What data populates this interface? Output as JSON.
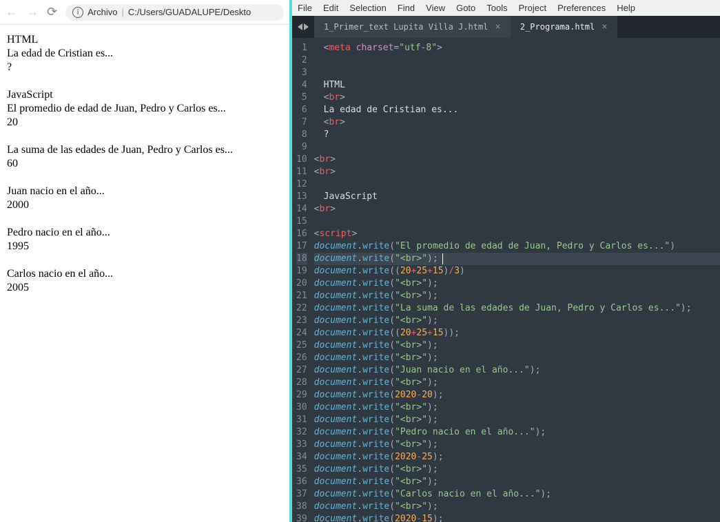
{
  "browser": {
    "address": {
      "label": "Archivo",
      "path": "C:/Users/GUADALUPE/Deskto"
    },
    "lines": [
      "HTML",
      "La edad de Cristian es...",
      "?",
      "",
      "JavaScript",
      "El promedio de edad de Juan, Pedro y Carlos es...",
      "20",
      "",
      "La suma de las edades de Juan, Pedro y Carlos es...",
      "60",
      "",
      "Juan nacio en el año...",
      "2000",
      "",
      "Pedro nacio en el año...",
      "1995",
      "",
      "Carlos nacio en el año...",
      "2005"
    ]
  },
  "editor": {
    "menu": [
      "File",
      "Edit",
      "Selection",
      "Find",
      "View",
      "Goto",
      "Tools",
      "Project",
      "Preferences",
      "Help"
    ],
    "tabs": [
      {
        "label": "1_Primer_text Lupita Villa J.html",
        "active": false
      },
      {
        "label": "2_Programa.html",
        "active": true
      }
    ],
    "highlight_line": 18,
    "code": [
      {
        "n": 1,
        "seg": [
          [
            "p",
            "<"
          ],
          [
            "tg",
            "meta"
          ],
          [
            "p",
            " "
          ],
          [
            "at",
            "charset"
          ],
          [
            "p",
            "="
          ],
          [
            "st",
            "\"utf-8\""
          ],
          [
            "p",
            ">"
          ]
        ]
      },
      {
        "n": 2,
        "seg": []
      },
      {
        "n": 3,
        "seg": []
      },
      {
        "n": 4,
        "seg": [
          [
            "tx",
            "HTML"
          ]
        ]
      },
      {
        "n": 5,
        "seg": [
          [
            "p",
            "<"
          ],
          [
            "tg",
            "br"
          ],
          [
            "p",
            ">"
          ]
        ]
      },
      {
        "n": 6,
        "seg": [
          [
            "tx",
            "La edad de Cristian es..."
          ]
        ]
      },
      {
        "n": 7,
        "seg": [
          [
            "p",
            "<"
          ],
          [
            "tg",
            "br"
          ],
          [
            "p",
            ">"
          ]
        ]
      },
      {
        "n": 8,
        "seg": [
          [
            "tx",
            "?"
          ]
        ]
      },
      {
        "n": 9,
        "seg": []
      },
      {
        "n": 10,
        "seg": [
          [
            "p",
            "<"
          ],
          [
            "tg",
            "br"
          ],
          [
            "p",
            ">"
          ]
        ],
        "dedent": true
      },
      {
        "n": 11,
        "seg": [
          [
            "p",
            "<"
          ],
          [
            "tg",
            "br"
          ],
          [
            "p",
            ">"
          ]
        ],
        "dedent": true
      },
      {
        "n": 12,
        "seg": []
      },
      {
        "n": 13,
        "seg": [
          [
            "tx",
            "JavaScript"
          ]
        ]
      },
      {
        "n": 14,
        "seg": [
          [
            "p",
            "<"
          ],
          [
            "tg",
            "br"
          ],
          [
            "p",
            ">"
          ]
        ],
        "dedent": true
      },
      {
        "n": 15,
        "seg": []
      },
      {
        "n": 16,
        "seg": [
          [
            "p",
            "<"
          ],
          [
            "tg",
            "script"
          ],
          [
            "p",
            ">"
          ]
        ],
        "dedent": true
      },
      {
        "n": 17,
        "seg": [
          [
            "kw",
            "document"
          ],
          [
            "p",
            "."
          ],
          [
            "fn",
            "write"
          ],
          [
            "p",
            "("
          ],
          [
            "st",
            "\"El promedio de edad de Juan, Pedro y Carlos es...\""
          ],
          [
            "p",
            ")"
          ]
        ],
        "dedent": true
      },
      {
        "n": 18,
        "seg": [
          [
            "kw",
            "document"
          ],
          [
            "p",
            "."
          ],
          [
            "fn",
            "write"
          ],
          [
            "p",
            "("
          ],
          [
            "st",
            "\"<br>\""
          ],
          [
            "p",
            ");"
          ]
        ],
        "dedent": true,
        "cursor": 186
      },
      {
        "n": 19,
        "seg": [
          [
            "kw",
            "document"
          ],
          [
            "p",
            "."
          ],
          [
            "fn",
            "write"
          ],
          [
            "p",
            "(("
          ],
          [
            "nm",
            "20"
          ],
          [
            "op",
            "+"
          ],
          [
            "nm",
            "25"
          ],
          [
            "op",
            "+"
          ],
          [
            "nm",
            "15"
          ],
          [
            "p",
            ")"
          ],
          [
            "op",
            "/"
          ],
          [
            "nm",
            "3"
          ],
          [
            "p",
            ")"
          ]
        ],
        "dedent": true
      },
      {
        "n": 20,
        "seg": [
          [
            "kw",
            "document"
          ],
          [
            "p",
            "."
          ],
          [
            "fn",
            "write"
          ],
          [
            "p",
            "("
          ],
          [
            "st",
            "\"<br>\""
          ],
          [
            "p",
            ");"
          ]
        ],
        "dedent": true
      },
      {
        "n": 21,
        "seg": [
          [
            "kw",
            "document"
          ],
          [
            "p",
            "."
          ],
          [
            "fn",
            "write"
          ],
          [
            "p",
            "("
          ],
          [
            "st",
            "\"<br>\""
          ],
          [
            "p",
            ");"
          ]
        ],
        "dedent": true
      },
      {
        "n": 22,
        "seg": [
          [
            "kw",
            "document"
          ],
          [
            "p",
            "."
          ],
          [
            "fn",
            "write"
          ],
          [
            "p",
            "("
          ],
          [
            "st",
            "\"La suma de las edades de Juan, Pedro y Carlos es...\""
          ],
          [
            "p",
            ");"
          ]
        ],
        "dedent": true
      },
      {
        "n": 23,
        "seg": [
          [
            "kw",
            "document"
          ],
          [
            "p",
            "."
          ],
          [
            "fn",
            "write"
          ],
          [
            "p",
            "("
          ],
          [
            "st",
            "\"<br>\""
          ],
          [
            "p",
            ");"
          ]
        ],
        "dedent": true
      },
      {
        "n": 24,
        "seg": [
          [
            "kw",
            "document"
          ],
          [
            "p",
            "."
          ],
          [
            "fn",
            "write"
          ],
          [
            "p",
            "(("
          ],
          [
            "nm",
            "20"
          ],
          [
            "op",
            "+"
          ],
          [
            "nm",
            "25"
          ],
          [
            "op",
            "+"
          ],
          [
            "nm",
            "15"
          ],
          [
            "p",
            "));"
          ]
        ],
        "dedent": true
      },
      {
        "n": 25,
        "seg": [
          [
            "kw",
            "document"
          ],
          [
            "p",
            "."
          ],
          [
            "fn",
            "write"
          ],
          [
            "p",
            "("
          ],
          [
            "st",
            "\"<br>\""
          ],
          [
            "p",
            ");"
          ]
        ],
        "dedent": true
      },
      {
        "n": 26,
        "seg": [
          [
            "kw",
            "document"
          ],
          [
            "p",
            "."
          ],
          [
            "fn",
            "write"
          ],
          [
            "p",
            "("
          ],
          [
            "st",
            "\"<br>\""
          ],
          [
            "p",
            ");"
          ]
        ],
        "dedent": true
      },
      {
        "n": 27,
        "seg": [
          [
            "kw",
            "document"
          ],
          [
            "p",
            "."
          ],
          [
            "fn",
            "write"
          ],
          [
            "p",
            "("
          ],
          [
            "st",
            "\"Juan nacio en el año...\""
          ],
          [
            "p",
            ");"
          ]
        ],
        "dedent": true
      },
      {
        "n": 28,
        "seg": [
          [
            "kw",
            "document"
          ],
          [
            "p",
            "."
          ],
          [
            "fn",
            "write"
          ],
          [
            "p",
            "("
          ],
          [
            "st",
            "\"<br>\""
          ],
          [
            "p",
            ");"
          ]
        ],
        "dedent": true
      },
      {
        "n": 29,
        "seg": [
          [
            "kw",
            "document"
          ],
          [
            "p",
            "."
          ],
          [
            "fn",
            "write"
          ],
          [
            "p",
            "("
          ],
          [
            "nm",
            "2020"
          ],
          [
            "op",
            "-"
          ],
          [
            "nm",
            "20"
          ],
          [
            "p",
            ");"
          ]
        ],
        "dedent": true
      },
      {
        "n": 30,
        "seg": [
          [
            "kw",
            "document"
          ],
          [
            "p",
            "."
          ],
          [
            "fn",
            "write"
          ],
          [
            "p",
            "("
          ],
          [
            "st",
            "\"<br>\""
          ],
          [
            "p",
            ");"
          ]
        ],
        "dedent": true
      },
      {
        "n": 31,
        "seg": [
          [
            "kw",
            "document"
          ],
          [
            "p",
            "."
          ],
          [
            "fn",
            "write"
          ],
          [
            "p",
            "("
          ],
          [
            "st",
            "\"<br>\""
          ],
          [
            "p",
            ");"
          ]
        ],
        "dedent": true
      },
      {
        "n": 32,
        "seg": [
          [
            "kw",
            "document"
          ],
          [
            "p",
            "."
          ],
          [
            "fn",
            "write"
          ],
          [
            "p",
            "("
          ],
          [
            "st",
            "\"Pedro nacio en el año...\""
          ],
          [
            "p",
            ");"
          ]
        ],
        "dedent": true
      },
      {
        "n": 33,
        "seg": [
          [
            "kw",
            "document"
          ],
          [
            "p",
            "."
          ],
          [
            "fn",
            "write"
          ],
          [
            "p",
            "("
          ],
          [
            "st",
            "\"<br>\""
          ],
          [
            "p",
            ");"
          ]
        ],
        "dedent": true
      },
      {
        "n": 34,
        "seg": [
          [
            "kw",
            "document"
          ],
          [
            "p",
            "."
          ],
          [
            "fn",
            "write"
          ],
          [
            "p",
            "("
          ],
          [
            "nm",
            "2020"
          ],
          [
            "op",
            "-"
          ],
          [
            "nm",
            "25"
          ],
          [
            "p",
            ");"
          ]
        ],
        "dedent": true
      },
      {
        "n": 35,
        "seg": [
          [
            "kw",
            "document"
          ],
          [
            "p",
            "."
          ],
          [
            "fn",
            "write"
          ],
          [
            "p",
            "("
          ],
          [
            "st",
            "\"<br>\""
          ],
          [
            "p",
            ");"
          ]
        ],
        "dedent": true
      },
      {
        "n": 36,
        "seg": [
          [
            "kw",
            "document"
          ],
          [
            "p",
            "."
          ],
          [
            "fn",
            "write"
          ],
          [
            "p",
            "("
          ],
          [
            "st",
            "\"<br>\""
          ],
          [
            "p",
            ");"
          ]
        ],
        "dedent": true
      },
      {
        "n": 37,
        "seg": [
          [
            "kw",
            "document"
          ],
          [
            "p",
            "."
          ],
          [
            "fn",
            "write"
          ],
          [
            "p",
            "("
          ],
          [
            "st",
            "\"Carlos nacio en el año...\""
          ],
          [
            "p",
            ");"
          ]
        ],
        "dedent": true
      },
      {
        "n": 38,
        "seg": [
          [
            "kw",
            "document"
          ],
          [
            "p",
            "."
          ],
          [
            "fn",
            "write"
          ],
          [
            "p",
            "("
          ],
          [
            "st",
            "\"<br>\""
          ],
          [
            "p",
            ");"
          ]
        ],
        "dedent": true
      },
      {
        "n": 39,
        "seg": [
          [
            "kw",
            "document"
          ],
          [
            "p",
            "."
          ],
          [
            "fn",
            "write"
          ],
          [
            "p",
            "("
          ],
          [
            "nm",
            "2020"
          ],
          [
            "op",
            "-"
          ],
          [
            "nm",
            "15"
          ],
          [
            "p",
            ");"
          ]
        ],
        "dedent": true
      }
    ]
  }
}
